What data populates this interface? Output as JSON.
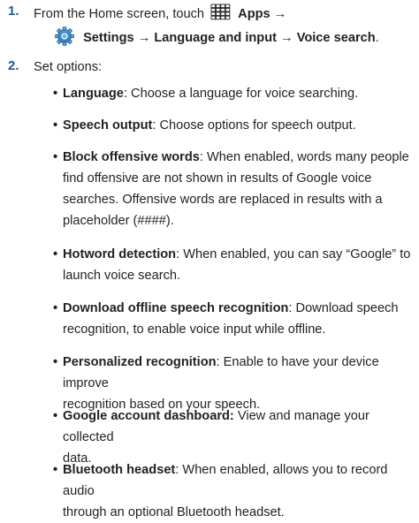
{
  "page_header_fragment": "",
  "steps": [
    {
      "number": "1.",
      "line1_prefix": "From the Home screen, touch",
      "apps_label": "Apps",
      "arrow": "→",
      "settings_label": "Settings",
      "path_rest": "→ Language and input → Voice search",
      "period": "."
    },
    {
      "number": "2.",
      "text": "Set options:"
    }
  ],
  "options": [
    {
      "term": "Language",
      "sep": ":",
      "desc": " Choose a language for voice searching.",
      "lines": []
    },
    {
      "term": "Speech output",
      "sep": ":",
      "desc": " Choose options for speech output.",
      "lines": []
    },
    {
      "term": "Block offensive words",
      "sep": ":",
      "desc": " When enabled, words many people",
      "lines": [
        "find offensive are not shown in results of Google voice",
        "searches. Offensive words are replaced in results with a",
        "placeholder (####)."
      ]
    },
    {
      "term": "Hotword detection",
      "sep": ":",
      "desc": " When enabled, you can say “Google” to",
      "lines": [
        "launch voice search."
      ]
    },
    {
      "term": "Download offline speech recognition",
      "sep": ":",
      "desc": " Download speech",
      "lines": [
        "recognition, to enable voice input while offline."
      ]
    },
    {
      "term": "Personalized recognition",
      "sep": ":",
      "desc": " Enable to have your device improve",
      "lines": [
        "recognition based on your speech."
      ]
    },
    {
      "term": "Google account dashboard:",
      "sep": "",
      "desc": " View and manage your collected",
      "lines": [
        "data."
      ]
    },
    {
      "term": "Bluetooth headset",
      "sep": ":",
      "desc": " When enabled, allows you to record audio",
      "lines": [
        "through an optional Bluetooth headset."
      ]
    }
  ],
  "bullet_char": "•",
  "icons": {
    "apps": "apps-grid-icon",
    "settings": "settings-gear-icon"
  },
  "colors": {
    "step_number": "#1a5a9c",
    "text": "#231f20",
    "settings_icon": "#2f7fc1"
  }
}
